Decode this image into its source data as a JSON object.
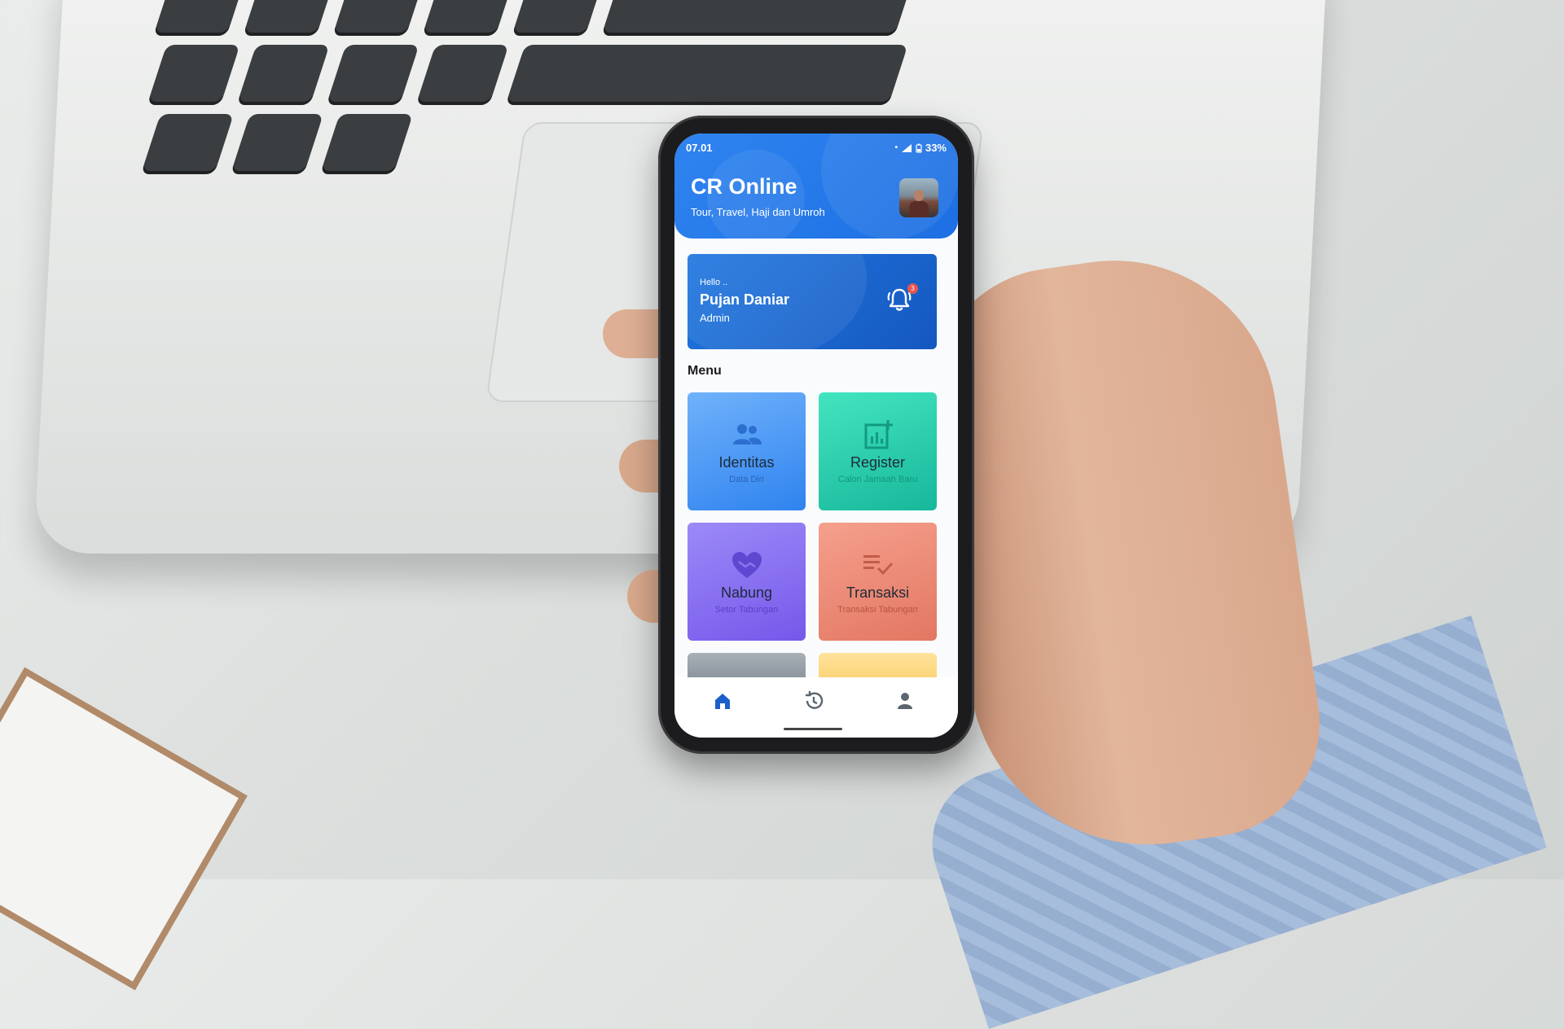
{
  "status_bar": {
    "time": "07.01",
    "battery": "33%"
  },
  "app": {
    "title": "CR Online",
    "subtitle": "Tour, Travel, Haji dan Umroh"
  },
  "greeting": {
    "hello": "Hello ..",
    "name": "Pujan Daniar",
    "role": "Admin",
    "notification_count": "3"
  },
  "menu": {
    "label": "Menu",
    "items": [
      {
        "title": "Identitas",
        "subtitle": "Data Diri",
        "icon": "users-icon"
      },
      {
        "title": "Register",
        "subtitle": "Calon Jamaah Baru",
        "icon": "add-chart-icon"
      },
      {
        "title": "Nabung",
        "subtitle": "Setor Tabungan",
        "icon": "heart-hand-icon"
      },
      {
        "title": "Transaksi",
        "subtitle": "Transaksi Tabungan",
        "icon": "checklist-icon"
      }
    ]
  },
  "bottom_nav": {
    "items": [
      {
        "icon": "home-icon",
        "active": true
      },
      {
        "icon": "history-icon",
        "active": false
      },
      {
        "icon": "profile-icon",
        "active": false
      }
    ]
  },
  "colors": {
    "primary": "#1d6fe3",
    "card": "#1458c0",
    "identitas": "#2f83ef",
    "register": "#17b79b",
    "nabung": "#7658ea",
    "transaksi": "#e27762",
    "badge": "#e8544d"
  }
}
